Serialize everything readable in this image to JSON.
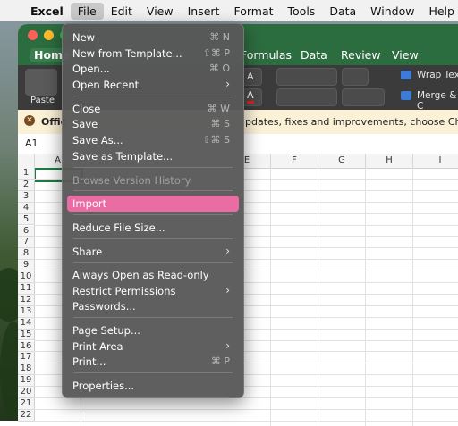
{
  "menubar": {
    "items": [
      "Excel",
      "File",
      "Edit",
      "View",
      "Insert",
      "Format",
      "Tools",
      "Data",
      "Window",
      "Help"
    ],
    "active": "File"
  },
  "ribbon": {
    "tabs": {
      "home": "Home",
      "formulas": "Formulas",
      "data": "Data",
      "review": "Review",
      "view": "View"
    },
    "paste_label": "Paste",
    "wrap_text": "Wrap Text",
    "merge": "Merge & C",
    "font_size_label": "A"
  },
  "notice": {
    "prefix": "Offic",
    "text": "pdates, fixes and improvements, choose Check for U"
  },
  "formula_bar": {
    "cell_ref": "A1"
  },
  "grid": {
    "columns": [
      "A",
      "E",
      "F",
      "G",
      "H",
      "I"
    ],
    "rows": [
      "1",
      "2",
      "3",
      "4",
      "5",
      "6",
      "7",
      "8",
      "9",
      "10",
      "11",
      "12",
      "13",
      "14",
      "15",
      "16",
      "17",
      "18",
      "19",
      "20",
      "21",
      "22"
    ]
  },
  "file_menu": {
    "items": [
      {
        "label": "New",
        "shortcut": "⌘ N"
      },
      {
        "label": "New from Template...",
        "shortcut": "⇧⌘ P"
      },
      {
        "label": "Open...",
        "shortcut": "⌘ O"
      },
      {
        "label": "Open Recent",
        "submenu": true
      },
      {
        "label": "Close",
        "shortcut": "⌘ W"
      },
      {
        "label": "Save",
        "shortcut": "⌘ S"
      },
      {
        "label": "Save As...",
        "shortcut": "⇧⌘ S"
      },
      {
        "label": "Save as Template..."
      },
      {
        "label": "Browse Version History",
        "disabled": true
      },
      {
        "label": "Import",
        "highlighted": true
      },
      {
        "label": "Reduce File Size..."
      },
      {
        "label": "Share",
        "submenu": true
      },
      {
        "label": "Always Open as Read-only"
      },
      {
        "label": "Restrict Permissions",
        "submenu": true
      },
      {
        "label": "Passwords..."
      },
      {
        "label": "Page Setup..."
      },
      {
        "label": "Print Area",
        "submenu": true
      },
      {
        "label": "Print...",
        "shortcut": "⌘ P"
      },
      {
        "label": "Properties..."
      }
    ]
  },
  "colors": {
    "excel_green": "#2c6d3f",
    "menu_bg": "#585858",
    "highlight": "#e96da3",
    "notice_bg": "#fbf1d6"
  }
}
